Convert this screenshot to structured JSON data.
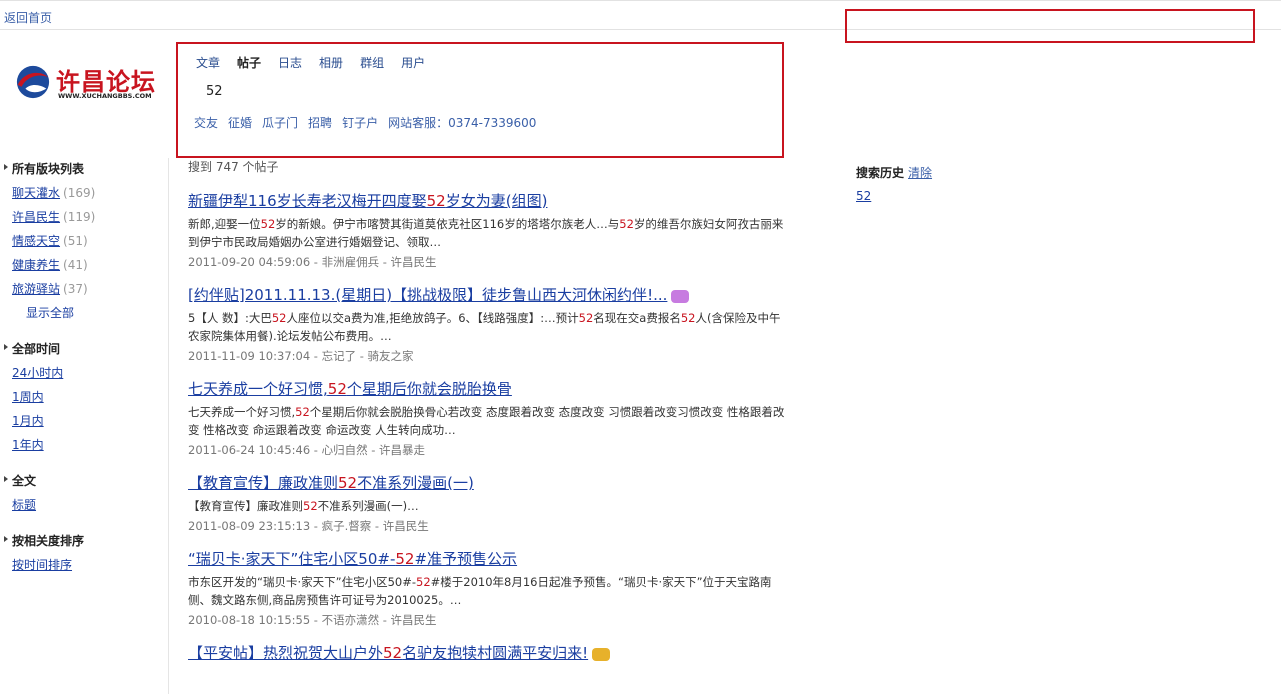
{
  "top": {
    "back_home": "返回首页"
  },
  "logo": {
    "name": "许昌论坛",
    "url": "WWW.XUCHANGBBS.COM"
  },
  "search": {
    "tabs": [
      "文章",
      "帖子",
      "日志",
      "相册",
      "群组",
      "用户"
    ],
    "active_tab": "帖子",
    "query": "52",
    "hot_links": [
      "交友",
      "征婚",
      "瓜子门",
      "招聘",
      "钉子户",
      "网站客服：0374-7339600"
    ]
  },
  "result_count": "搜到 747 个帖子",
  "sidebar": {
    "forums": {
      "title": "所有版块列表",
      "items": [
        {
          "label": "聊天灌水",
          "count": "(169)"
        },
        {
          "label": "许昌民生",
          "count": "(119)"
        },
        {
          "label": "情感天空",
          "count": "(51)"
        },
        {
          "label": "健康养生",
          "count": "(41)"
        },
        {
          "label": "旅游驿站",
          "count": "(37)"
        }
      ],
      "show_all": "显示全部"
    },
    "time": {
      "title": "全部时间",
      "items": [
        "24小时内",
        "1周内",
        "1月内",
        "1年内"
      ]
    },
    "fulltext": {
      "title": "全文",
      "items": [
        "标题"
      ]
    },
    "sort": {
      "title": "按相关度排序",
      "items": [
        "按时间排序"
      ]
    }
  },
  "results": [
    {
      "title_pre": "新疆伊犁116岁长寿老汉梅开四度娶",
      "title_hl": "52",
      "title_post": "岁女为妻(组图)",
      "snippet_parts": [
        "新郎,迎娶一位",
        "52",
        "岁的新娘。伊宁市喀赞其街道莫依克社区116岁的塔塔尔族老人…与",
        "52",
        "岁的维吾尔族妇女阿孜古丽来到伊宁市民政局婚姻办公室进行婚姻登记、领取…"
      ],
      "meta": "2011-09-20 04:59:06 - 非洲雇佣兵 - 许昌民生",
      "icon": ""
    },
    {
      "title_pre": "[约伴贴]2011.11.13.(星期日)【挑战极限】徒步鲁山西大河休闲约伴!...",
      "title_hl": "",
      "title_post": "",
      "snippet_parts": [
        "5【人 数】:大巴",
        "52",
        "人座位以交a费为准,拒绝放鸽子。6、【线路强度】:…预计",
        "52",
        "名现在交a费报名",
        "52",
        "人(含保险及中午农家院集体用餐).论坛发帖公布费用。…"
      ],
      "meta": "2011-11-09 10:37:04 - 忘记了 - 骑友之家",
      "icon": "purple"
    },
    {
      "title_pre": "七天养成一个好习惯,",
      "title_hl": "52",
      "title_post": "个星期后你就会脱胎换骨",
      "snippet_parts": [
        "七天养成一个好习惯,",
        "52",
        "个星期后你就会脱胎换骨心若改变 态度跟着改变 态度改变 习惯跟着改变习惯改变 性格跟着改变 性格改变 命运跟着改变 命运改变 人生转向成功…"
      ],
      "meta": "2011-06-24 10:45:46 - 心归自然 - 许昌暴走",
      "icon": ""
    },
    {
      "title_pre": "【教育宣传】廉政准则",
      "title_hl": "52",
      "title_post": "不准系列漫画(一)",
      "snippet_parts": [
        "【教育宣传】廉政准则",
        "52",
        "不准系列漫画(一)…"
      ],
      "meta": "2011-08-09 23:15:13 - 疯子.督察 - 许昌民生",
      "icon": ""
    },
    {
      "title_pre": "“瑞贝卡·家天下”住宅小区50#-",
      "title_hl": "52",
      "title_post": "#准予预售公示",
      "snippet_parts": [
        "市东区开发的“瑞贝卡·家天下”住宅小区50#-",
        "52",
        "#楼于2010年8月16日起准予预售。“瑞贝卡·家天下”位于天宝路南侧、魏文路东侧,商品房预售许可证号为2010025。…"
      ],
      "meta": "2010-08-18 10:15:55 - 不语亦潇然 - 许昌民生",
      "icon": ""
    },
    {
      "title_pre": "【平安帖】热烈祝贺大山户外",
      "title_hl": "52",
      "title_post": "名驴友抱犊村圆满平安归来!",
      "snippet_parts": [],
      "meta": "",
      "icon": "gold"
    }
  ],
  "history": {
    "title": "搜索历史",
    "clear": "清除",
    "items": [
      "52"
    ]
  },
  "colors": {
    "highlight": "#c8141f",
    "link": "#1a3ea1",
    "annotation_box": "#c8141f"
  }
}
